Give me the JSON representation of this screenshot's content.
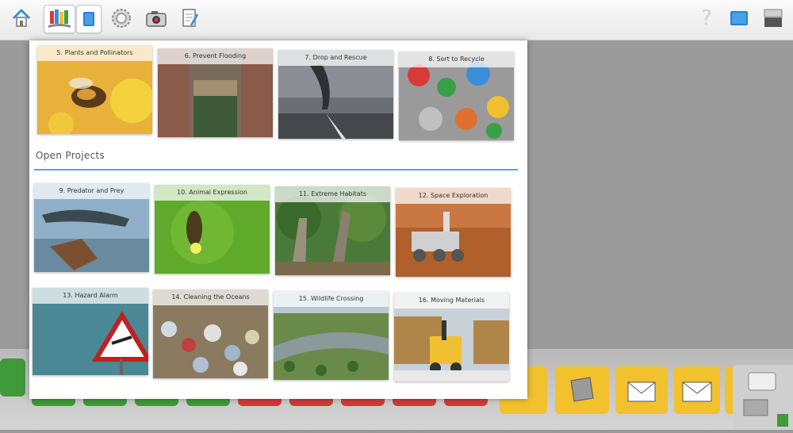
{
  "toolbar": {
    "items": [
      {
        "name": "home-icon"
      },
      {
        "name": "projects-icon"
      },
      {
        "name": "document-icon"
      },
      {
        "name": "settings-gear-icon"
      },
      {
        "name": "camera-icon"
      },
      {
        "name": "notes-icon"
      }
    ],
    "help_label": "?"
  },
  "panel": {
    "top_cards": [
      {
        "label": "5. Plants and Pollinators"
      },
      {
        "label": "6. Prevent Flooding"
      },
      {
        "label": "7. Drop and Rescue"
      },
      {
        "label": "8. Sort to Recycle"
      }
    ],
    "open_projects_title": "Open Projects",
    "open_projects": [
      {
        "label": "9. Predator and Prey"
      },
      {
        "label": "10. Animal Expression"
      },
      {
        "label": "11. Extreme Habitats"
      },
      {
        "label": "12. Space Exploration"
      },
      {
        "label": "13. Hazard Alarm"
      },
      {
        "label": "14. Cleaning the Oceans"
      },
      {
        "label": "15. Wildlife Crossing"
      },
      {
        "label": "16. Moving Materials"
      }
    ]
  },
  "colors": {
    "accent": "#5aa3e6",
    "toolbar_bg": "#f2f2f2",
    "canvas_bg": "#9b9b9b",
    "palette_green": "#3f9a3a",
    "palette_red": "#d23a3a",
    "palette_yellow": "#f2c12e"
  }
}
